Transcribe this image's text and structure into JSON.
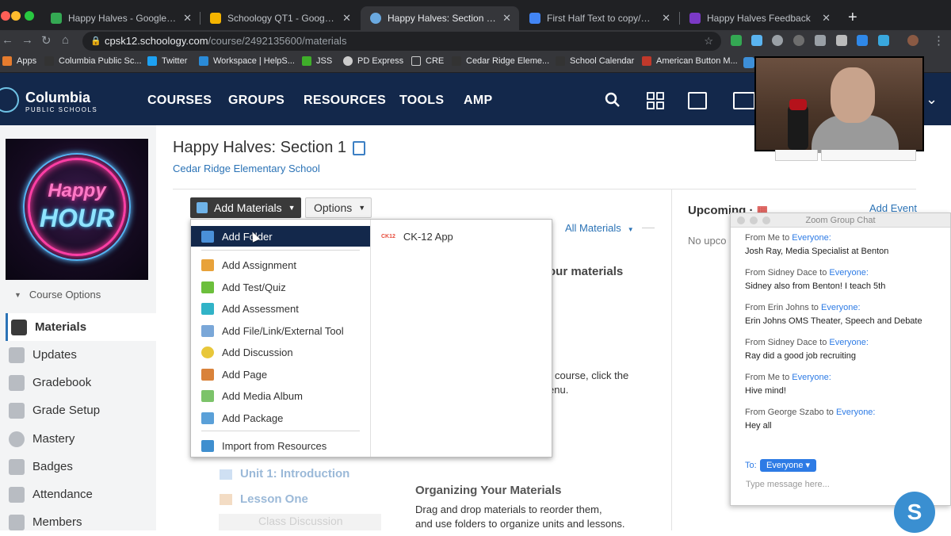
{
  "browser": {
    "tabs": [
      {
        "label": "Happy Halves - Google Drive",
        "color": "#34a853"
      },
      {
        "label": "Schoology QT1 - Google Slides",
        "color": "#f4b400"
      },
      {
        "label": "Happy Halves: Section 1 | Schoology",
        "color": "#6aa9e0"
      },
      {
        "label": "First Half Text to copy/paste - Google Docs",
        "color": "#4285f4"
      },
      {
        "label": "Happy Halves Feedback",
        "color": "#7b39c6"
      }
    ],
    "tab_close": "✕",
    "new_tab": "+",
    "url_host": "cpsk12.schoology.com",
    "url_path": "/course/2492135600/materials",
    "bookmarks": [
      {
        "label": "Apps"
      },
      {
        "label": "Columbia Public Sc..."
      },
      {
        "label": "Twitter"
      },
      {
        "label": "Workspace | HelpS..."
      },
      {
        "label": "JSS"
      },
      {
        "label": "PD Express"
      },
      {
        "label": "CRE"
      },
      {
        "label": "Cedar Ridge Eleme..."
      },
      {
        "label": "School Calendar"
      },
      {
        "label": "American Button M..."
      }
    ]
  },
  "site": {
    "logo_name": "Columbia",
    "logo_sub": "PUBLIC SCHOOLS",
    "nav": [
      "COURSES",
      "GROUPS",
      "RESOURCES",
      "TOOLS",
      "AMP"
    ]
  },
  "sidebar": {
    "poster_line1": "Happy",
    "poster_line2": "HOUR",
    "course_options": "Course Options",
    "items": [
      {
        "label": "Materials",
        "icon": "materials-icon"
      },
      {
        "label": "Updates",
        "icon": "updates-icon"
      },
      {
        "label": "Gradebook",
        "icon": "gradebook-icon"
      },
      {
        "label": "Grade Setup",
        "icon": "grade-setup-icon"
      },
      {
        "label": "Mastery",
        "icon": "mastery-icon"
      },
      {
        "label": "Badges",
        "icon": "badges-icon"
      },
      {
        "label": "Attendance",
        "icon": "attendance-icon"
      },
      {
        "label": "Members",
        "icon": "members-icon"
      }
    ]
  },
  "main": {
    "title": "Happy Halves: Section 1",
    "school": "Cedar Ridge Elementary School",
    "add_materials": "Add Materials",
    "options": "Options",
    "all_materials": "All Materials",
    "bg_text_a": "our materials",
    "bg_text_b1": "course, click the",
    "bg_text_b2": "enu.",
    "unit": "Unit 1: Introduction",
    "lesson": "Lesson One",
    "class_disc": "Class Discussion",
    "org_title": "Organizing Your Materials",
    "org_body1": "Drag and drop materials to reorder them,",
    "org_body2": "and use folders to organize units and lessons."
  },
  "dropdown": {
    "items": [
      {
        "label": "Add Folder",
        "color": "#4a90d9"
      },
      {
        "label": "Add Assignment",
        "color": "#e8a23a"
      },
      {
        "label": "Add Test/Quiz",
        "color": "#6cbf3c"
      },
      {
        "label": "Add Assessment",
        "color": "#31b3c7"
      },
      {
        "label": "Add File/Link/External Tool",
        "color": "#7aa7d8"
      },
      {
        "label": "Add Discussion",
        "color": "#e8c73a"
      },
      {
        "label": "Add Page",
        "color": "#d9823a"
      },
      {
        "label": "Add Media Album",
        "color": "#7cc36a"
      },
      {
        "label": "Add Package",
        "color": "#5aa0d8"
      },
      {
        "label": "Import from Resources",
        "color": "#3f8fcf"
      }
    ],
    "app_label": "CK-12 App",
    "app_icon": "CK12"
  },
  "upcoming": {
    "title": "Upcoming",
    "add_event": "Add Event",
    "none": "No upco"
  },
  "zoom_chat": {
    "title": "Zoom Group Chat",
    "messages": [
      {
        "from": "From Me to ",
        "to": "Everyone:",
        "text": "Josh Ray, Media Specialist at Benton"
      },
      {
        "from": "From Sidney Dace to ",
        "to": "Everyone:",
        "text": "Sidney also from Benton! I teach 5th"
      },
      {
        "from": "From Erin Johns to ",
        "to": "Everyone:",
        "text": "Erin Johns OMS Theater, Speech and Debate"
      },
      {
        "from": "From Sidney Dace to ",
        "to": "Everyone:",
        "text": "Ray did a good job recruiting"
      },
      {
        "from": "From Me to ",
        "to": "Everyone:",
        "text": "Hive mind!"
      },
      {
        "from": "From George Szabo to ",
        "to": "Everyone:",
        "text": "Hey all"
      }
    ],
    "to_label": "To:",
    "to_value": "Everyone ▾",
    "placeholder": "Type message here..."
  },
  "fab": "S"
}
